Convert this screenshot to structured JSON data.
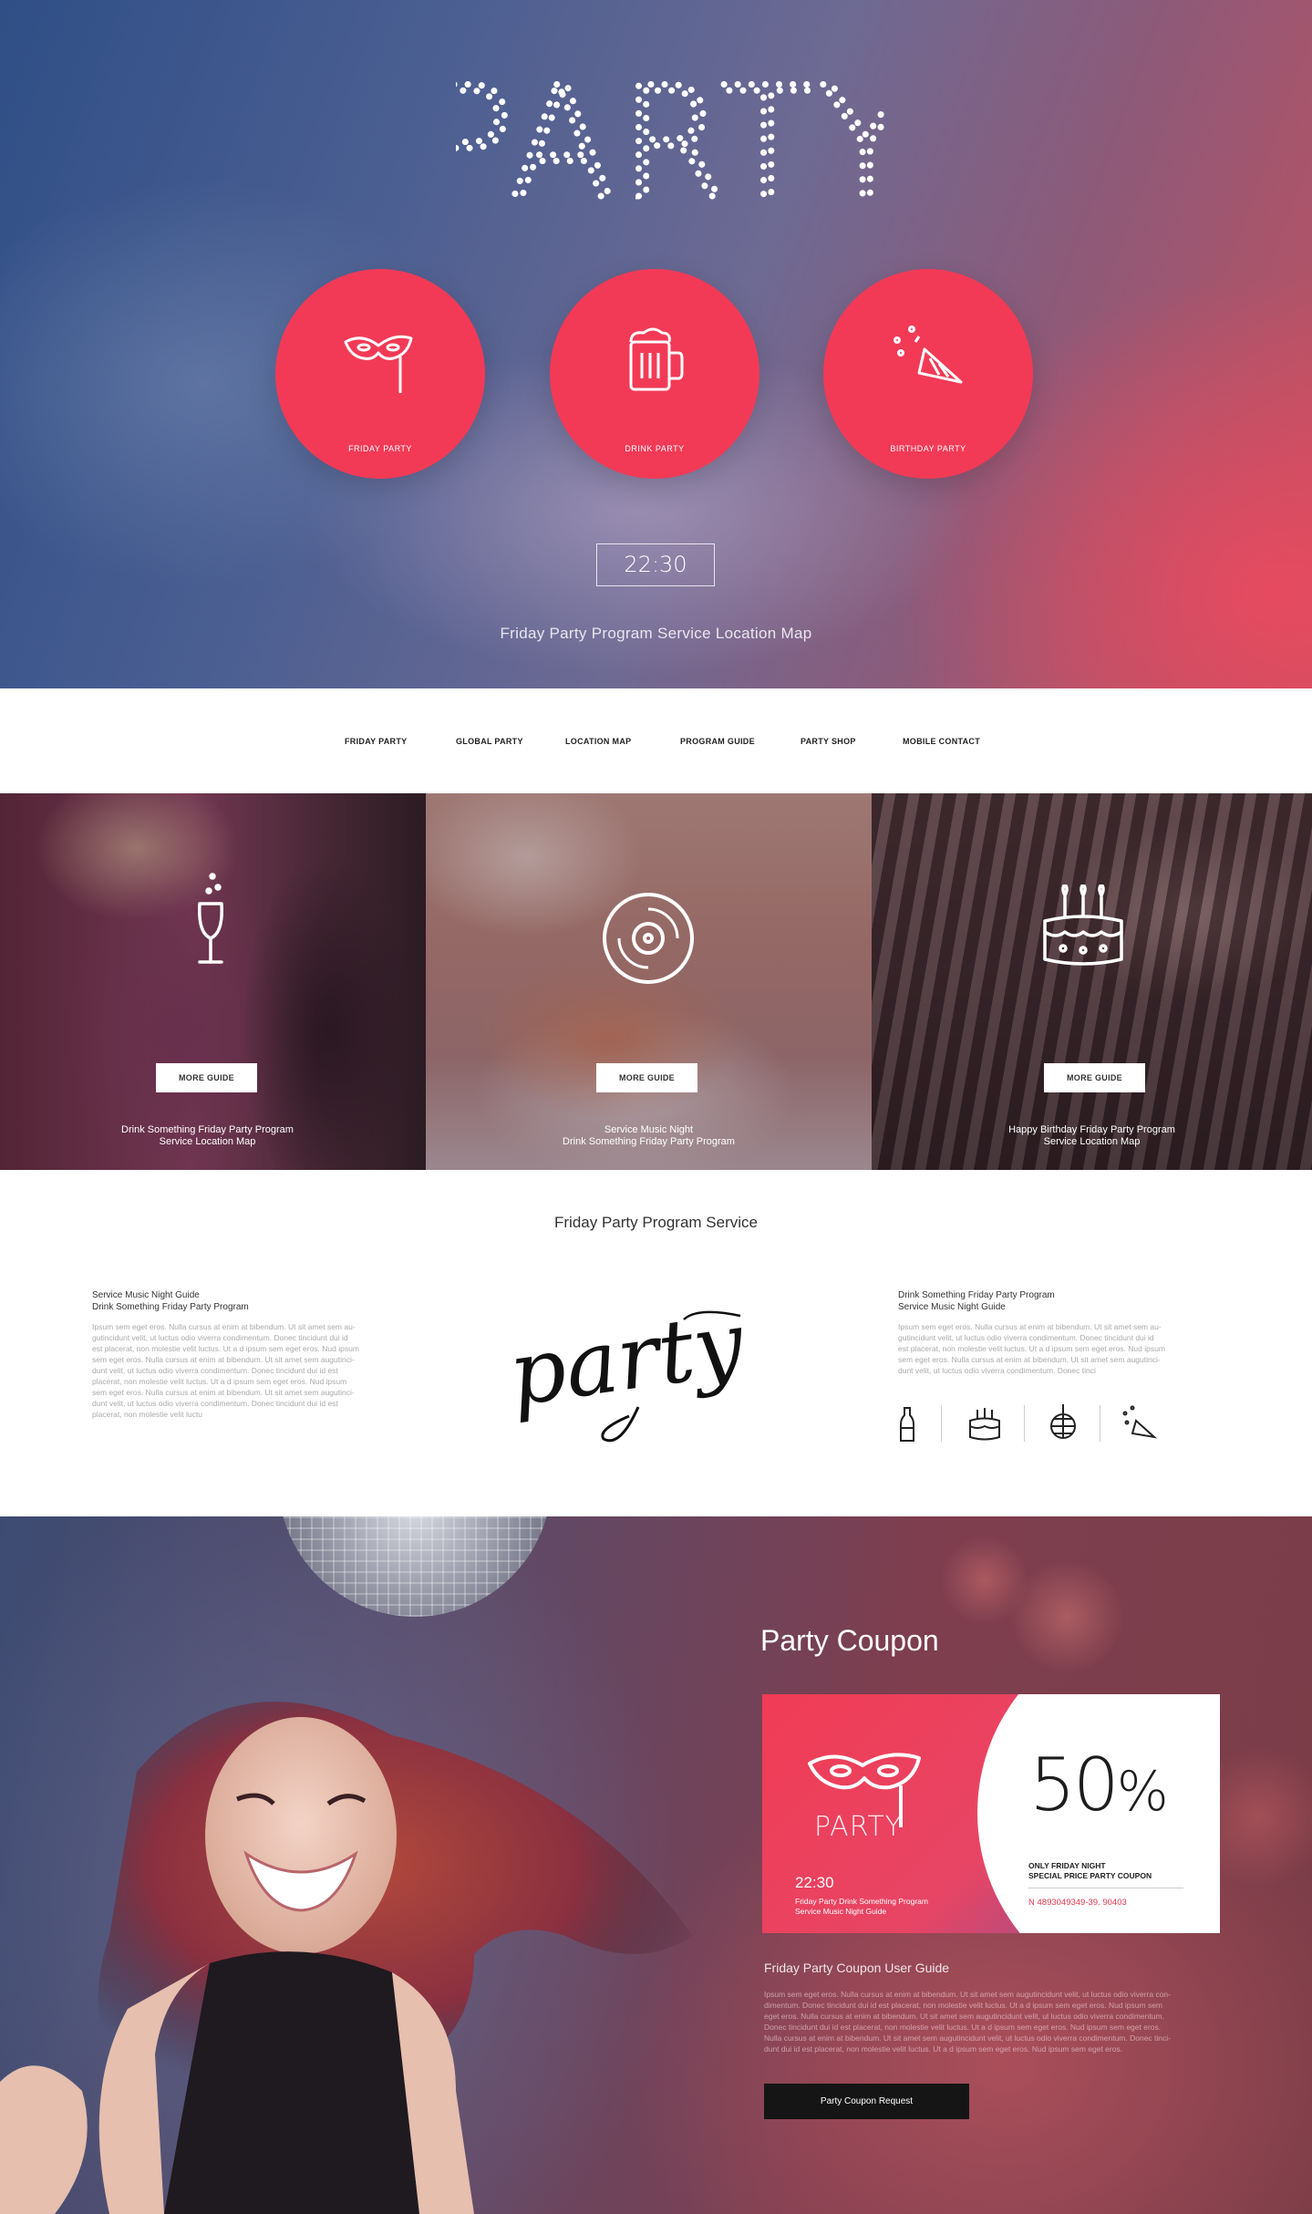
{
  "hero": {
    "title": "PARTY",
    "circles": [
      {
        "label": "FRIDAY PARTY",
        "icon": "mask-icon"
      },
      {
        "label": "DRINK PARTY",
        "icon": "beer-mug-icon"
      },
      {
        "label": "BIRTHDAY PARTY",
        "icon": "party-popper-icon"
      }
    ],
    "time": "22:30",
    "subtitle": "Friday Party Program Service Location Map"
  },
  "nav": {
    "items": [
      "FRIDAY PARTY",
      "GLOBAL PARTY",
      "LOCATION MAP",
      "PROGRAM GUIDE",
      "PARTY SHOP",
      "MOBILE CONTACT"
    ]
  },
  "panels": [
    {
      "button": "MORE GUIDE",
      "caption_line1": "Drink Something Friday Party Program",
      "caption_line2": "Service Location Map",
      "icon": "champagne-glass-icon"
    },
    {
      "button": "MORE GUIDE",
      "caption_line1": "Service Music Night",
      "caption_line2": "Drink Something Friday Party Program",
      "icon": "vinyl-record-icon"
    },
    {
      "button": "MORE GUIDE",
      "caption_line1": "Happy Birthday Friday Party Program",
      "caption_line2": "Service Location Map",
      "icon": "birthday-cake-icon"
    }
  ],
  "service": {
    "title": "Friday Party Program Service",
    "logo_text": "party",
    "left": {
      "head1": "Service Music Night Guide",
      "head2": "Drink Something Friday Party Program",
      "body": [
        "Ipsum sem eget eros. Nulla cursus at enim at bibendum. Ut sit amet sem au-",
        "gutincidunt velit, ut luctus odio viverra condimentum. Donec tincidunt dui id",
        "est placerat, non molestie velit luctus. Ut a d ipsum sem eget eros. Nud ipsum",
        "sem eget eros. Nulla cursus at enim at bibendum. Ut sit amet sem augutinci-",
        "dunt velit, ut luctus odio viverra condimentum. Donec tincidunt dui id est",
        "placerat, non molestie velit luctus. Ut a d ipsum sem eget eros. Nud ipsum",
        "sem eget eros. Nulla cursus at enim at bibendum. Ut sit amet sem augutinci-",
        "dunt velit, ut luctus odio viverra condimentum. Donec tincidunt dui id est",
        "placerat, non molestie velit luctu"
      ]
    },
    "right": {
      "head1": "Drink Something Friday Party Program",
      "head2": "Service Music Night Guide",
      "body": [
        "Ipsum sem eget eros. Nulla cursus at enim at bibendum. Ut sit amet sem au-",
        "gutincidunt velit, ut luctus odio viverra condimentum. Donec tincidunt dui id",
        "est placerat, non molestie velit luctus. Ut a d ipsum sem eget eros. Nud ipsum",
        "sem eget eros. Nulla cursus at enim at bibendum. Ut sit amet sem augutinci-",
        "dunt velit, ut luctus odio viverra condimentum. Donec tinci"
      ]
    },
    "mini_icons": [
      "beer-bottle-icon",
      "cake-icon",
      "disco-ball-icon",
      "party-popper-icon"
    ]
  },
  "coupon": {
    "section_title": "Party Coupon",
    "card_label": "PARTY",
    "time": "22:30",
    "desc_line1": "Friday Party Drink Something Program",
    "desc_line2": "Service Music Night Guide",
    "percent": "50",
    "percent_sign": "%",
    "note_line1": "ONLY FRIDAY NIGHT",
    "note_line2": "SPECIAL PRICE PARTY COUPON",
    "code": "N 4893049349-39. 90403",
    "guide_title": "Friday Party Coupon User Guide",
    "guide_body": [
      "Ipsum sem eget eros. Nulla cursus at enim at bibendum. Ut sit amet sem augutincidunt velit, ut luctus odio viverra con-",
      "dimentum. Donec tincidunt dui id est placerat, non molestie velit luctus. Ut a d ipsum sem eget eros. Nud ipsum sem",
      "eget eros. Nulla cursus at enim at bibendum. Ut sit amet sem augutincidunt velit, ut luctus odio viverra condimentum.",
      "Donec tincidunt dui id est placerat, non molestie velit luctus. Ut a d ipsum sem eget eros. Nud ipsum sem eget eros.",
      "Nulla cursus at enim at bibendum. Ut sit amet sem augutincidunt velit, ut luctus odio viverra condimentum. Donec tinci-",
      "dunt dui id est placerat, non molestie velit luctus. Ut a d ipsum sem eget eros. Nud ipsum sem eget eros."
    ],
    "button": "Party Coupon Request"
  },
  "colors": {
    "accent": "#f23a56",
    "dark": "#151515"
  }
}
